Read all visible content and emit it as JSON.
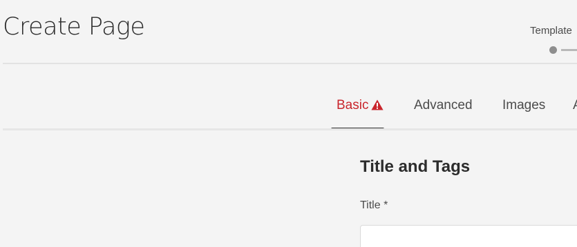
{
  "header": {
    "title": "Create Page",
    "wizard": {
      "current_step_label": "Template"
    }
  },
  "tabs": [
    {
      "label": "Basic",
      "selected": true,
      "status_icon": "alert-icon"
    },
    {
      "label": "Advanced",
      "selected": false
    },
    {
      "label": "Images",
      "selected": false
    },
    {
      "label": "A",
      "selected": false
    }
  ],
  "form": {
    "section_title": "Title and Tags",
    "title_field": {
      "label": "Title *",
      "value": "",
      "placeholder": ""
    }
  },
  "colors": {
    "background": "#f4f4f4",
    "error_red": "#c9252c",
    "text_dark": "#2c2c2c",
    "text_muted": "#4b4b4b",
    "step_dot": "#8e8e8e"
  }
}
